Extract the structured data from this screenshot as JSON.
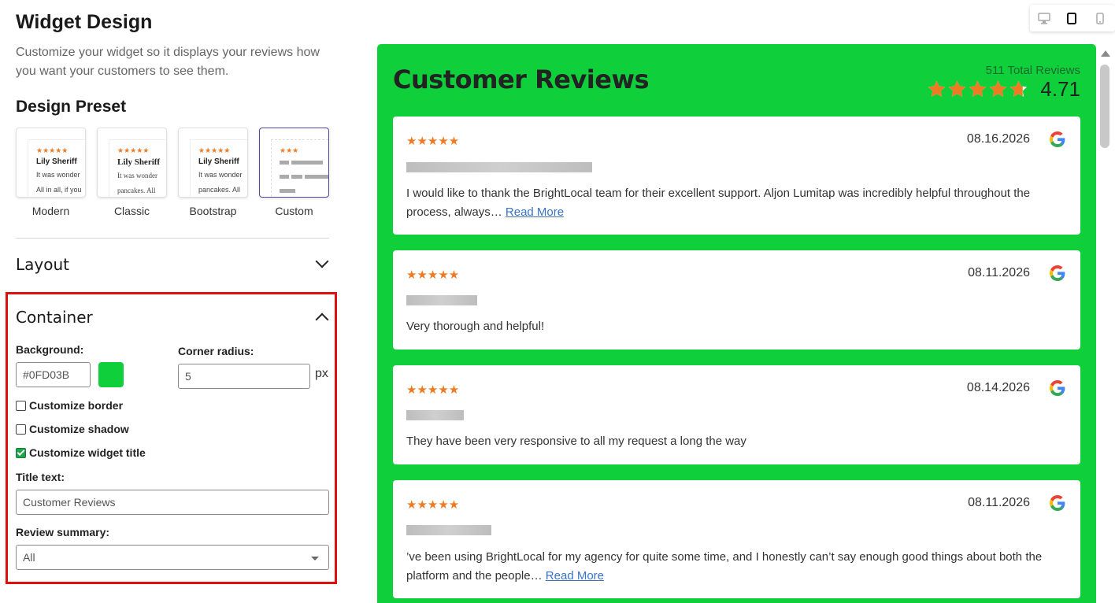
{
  "header": {
    "title": "Widget Design",
    "description": "Customize your widget so it displays your reviews how you want your customers to see them."
  },
  "design_preset": {
    "heading": "Design Preset",
    "presets": [
      {
        "label": "Modern",
        "stars": "★★★★★",
        "name": "Lily Sheriff",
        "line1": "It was wonder",
        "line2": "All in all, if you"
      },
      {
        "label": "Classic",
        "stars": "★★★★★",
        "name": "Lily Sheriff",
        "line1": "It was wonder",
        "line2": "pancakes. All"
      },
      {
        "label": "Bootstrap",
        "stars": "★★★★★",
        "name": "Lily Sheriff",
        "line1": "It was wonder",
        "line2": "pancakes. All"
      },
      {
        "label": "Custom",
        "stars": "★★★",
        "selected": true
      }
    ]
  },
  "layout_section": {
    "title": "Layout",
    "expanded": false
  },
  "container_section": {
    "title": "Container",
    "expanded": true,
    "background_label": "Background:",
    "background_value": "#0FD03B",
    "background_color": "#0FD03B",
    "corner_radius_label": "Corner radius:",
    "corner_radius_value": "5",
    "corner_radius_unit": "px",
    "customize_border": {
      "label": "Customize border",
      "checked": false
    },
    "customize_shadow": {
      "label": "Customize shadow",
      "checked": false
    },
    "customize_title": {
      "label": "Customize widget title",
      "checked": true
    },
    "title_text_label": "Title text:",
    "title_text_value": "Customer Reviews",
    "review_summary_label": "Review summary:",
    "review_summary_value": "All"
  },
  "device_toggle": {
    "icons": [
      "desktop-icon",
      "tablet-icon",
      "mobile-icon"
    ],
    "active": "tablet-icon"
  },
  "widget": {
    "title": "Customer Reviews",
    "total_reviews": "511 Total Reviews",
    "rating": "4.71",
    "rating_value": 4.71,
    "star_color": "#F07A22",
    "reviews": [
      {
        "stars": "★★★★★",
        "date": "08.16.2026",
        "text": "I would like to thank the BrightLocal team for their excellent support. Aljon Lumitap was incredibly helpful throughout the process, always…",
        "read_more": "Read More"
      },
      {
        "stars": "★★★★★",
        "date": "08.11.2026",
        "text": "Very thorough and helpful!",
        "read_more": ""
      },
      {
        "stars": "★★★★★",
        "date": "08.14.2026",
        "text": "They have been very responsive to all my request a long the way",
        "read_more": ""
      },
      {
        "stars": "★★★★★",
        "date": "08.11.2026",
        "text": "’ve been using BrightLocal for my agency for quite some time, and I honestly can’t say enough good things about both the platform and the people…",
        "read_more": "Read More"
      }
    ]
  }
}
